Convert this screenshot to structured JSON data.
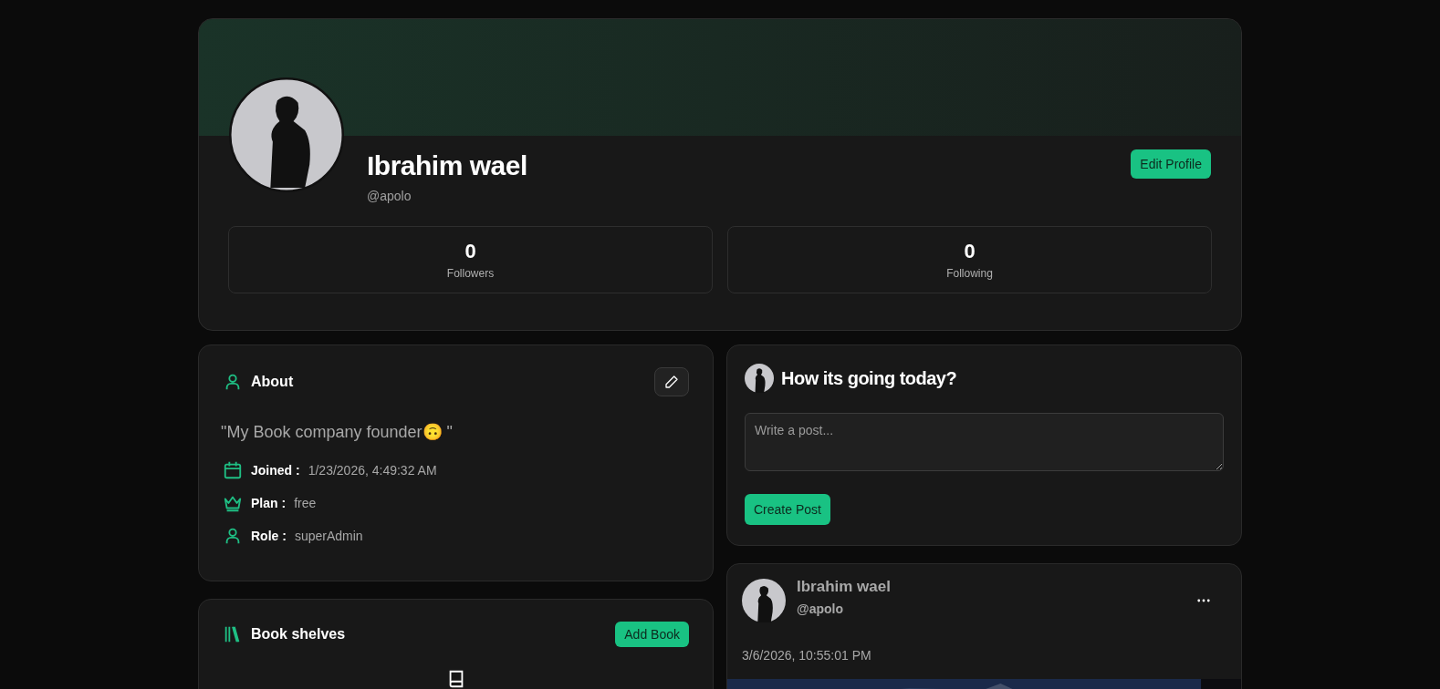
{
  "profile": {
    "name": "Ibrahim wael",
    "handle": "@apolo",
    "edit_button": "Edit Profile",
    "stats": [
      {
        "value": "0",
        "label": "Followers"
      },
      {
        "value": "0",
        "label": "Following"
      }
    ]
  },
  "about": {
    "title": "About",
    "bio": "\"My Book company founder🙃 \"",
    "details": [
      {
        "kind": "calendar",
        "label": "Joined :",
        "value": "1/23/2026, 4:49:32 AM"
      },
      {
        "kind": "crown",
        "label": "Plan :",
        "value": "free"
      },
      {
        "kind": "user",
        "label": "Role :",
        "value": "superAdmin"
      }
    ]
  },
  "shelves": {
    "title": "Book shelves",
    "button": "Add Book"
  },
  "composer": {
    "title": "How its going today?",
    "placeholder": "Write a post...",
    "button": "Create Post"
  },
  "post": {
    "name": "Ibrahim wael",
    "handle": "@apolo",
    "date": "3/6/2026, 10:55:01 PM"
  }
}
